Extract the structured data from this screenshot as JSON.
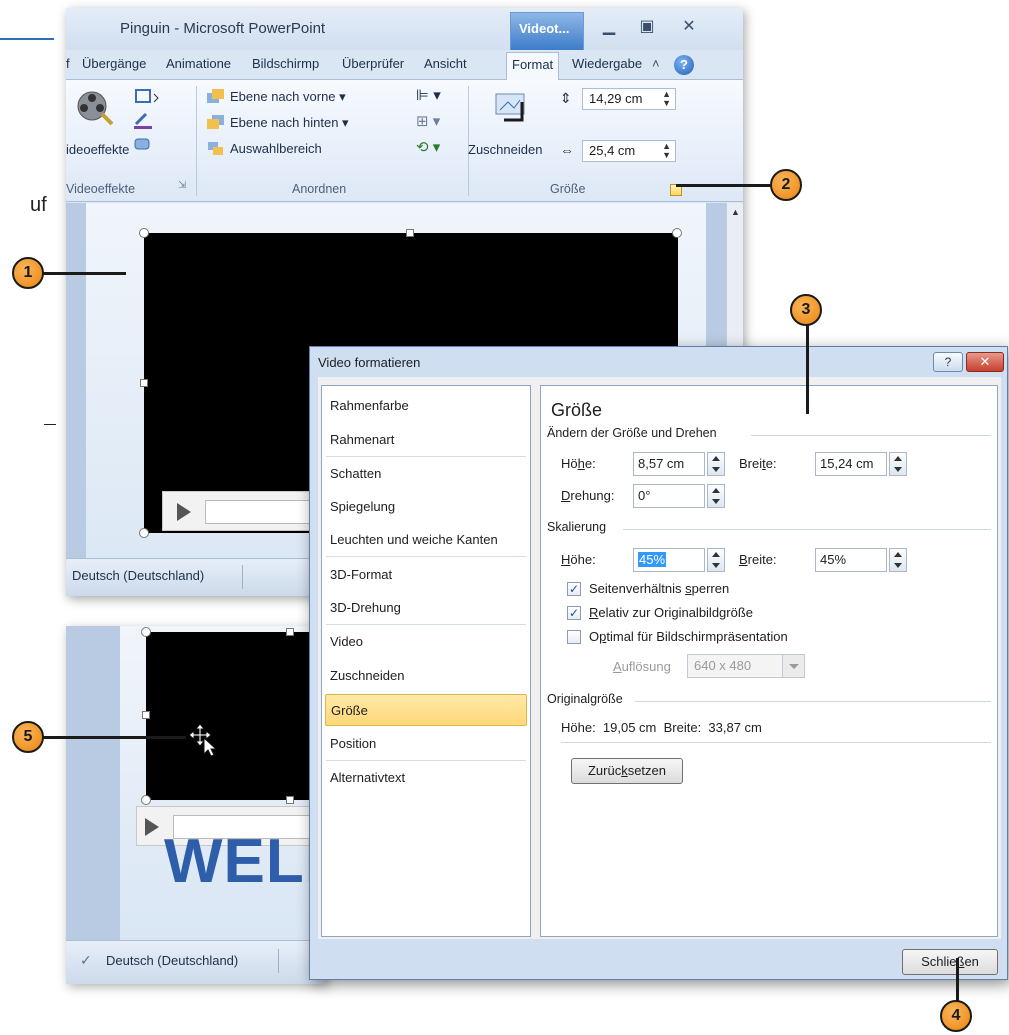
{
  "page": {
    "side_text_1": "uf",
    "side_text_2": "-"
  },
  "window": {
    "title": "Pinguin - Microsoft PowerPoint",
    "context_tab": "Videot...",
    "tabs": [
      "f",
      "Übergänge",
      "Animatione",
      "Bildschirmp",
      "Überprüfer",
      "Ansicht",
      "Format",
      "Wiedergabe"
    ],
    "active_tab": "Format"
  },
  "ribbon": {
    "videoeffekte_btn": "ideoeffekte",
    "videoeffekte_group": "Videoeffekte",
    "ebene_vorne": "Ebene nach vorne",
    "ebene_hinten": "Ebene nach hinten",
    "auswahlbereich": "Auswahlbereich",
    "anordnen_group": "Anordnen",
    "zuschneiden": "Zuschneiden",
    "hoehe_value": "14,29 cm",
    "breite_value": "25,4 cm",
    "groesse_group": "Größe"
  },
  "statusbar": {
    "language": "Deutsch (Deutschland)"
  },
  "slide2": {
    "welcome_text": "WELL"
  },
  "dialog": {
    "title": "Video formatieren",
    "help": "?",
    "close": "✕",
    "nav": [
      "Rahmenfarbe",
      "Rahmenart",
      "Schatten",
      "Spiegelung",
      "Leuchten und weiche Kanten",
      "3D-Format",
      "3D-Drehung",
      "Video",
      "Zuschneiden",
      "Größe",
      "Position",
      "Alternativtext"
    ],
    "selected_nav": "Größe",
    "panel_title": "Größe",
    "section_resize": "Ändern der Größe und Drehen",
    "hoehe_label_pre": "Hö",
    "hoehe_label_u": "h",
    "hoehe_label_post": "e:",
    "hoehe_value": "8,57 cm",
    "breite_label_pre": "Brei",
    "breite_label_u": "t",
    "breite_label_post": "e:",
    "breite_value": "15,24 cm",
    "drehung_label_u": "D",
    "drehung_label_post": "rehung:",
    "drehung_value": "0°",
    "section_scale": "Skalierung",
    "scale_hoehe_label_u": "H",
    "scale_hoehe_label_post": "öhe:",
    "scale_hoehe_value": "45%",
    "scale_breite_label_u": "B",
    "scale_breite_label_post": "reite:",
    "scale_breite_value": "45%",
    "cb_lock_pre": "Seitenverhältnis ",
    "cb_lock_u": "s",
    "cb_lock_post": "perren",
    "cb_relative_u": "R",
    "cb_relative_post": "elativ zur Originalbildgröße",
    "cb_optimal_pre": "O",
    "cb_optimal_u": "p",
    "cb_optimal_post": "timal für Bildschirmpräsentation",
    "aufloesung_label_u": "A",
    "aufloesung_label_post": "uflösung",
    "aufloesung_value": "640 x 480",
    "section_original": "Originalgröße",
    "original_text": "Höhe:  19,05 cm  Breite:  33,87 cm",
    "reset_pre": "Zurüc",
    "reset_u": "k",
    "reset_post": "setzen",
    "close_pre": "Schlie",
    "close_u": "ß",
    "close_post": "en"
  },
  "checkboxes": {
    "lock_aspect": true,
    "relative_original": true,
    "optimal_presentation": false
  },
  "callouts": [
    "1",
    "2",
    "3",
    "4",
    "5"
  ],
  "colors": {
    "callout": "#f29d2c",
    "selection": "#ffd878",
    "accent": "#3d7cc9"
  }
}
